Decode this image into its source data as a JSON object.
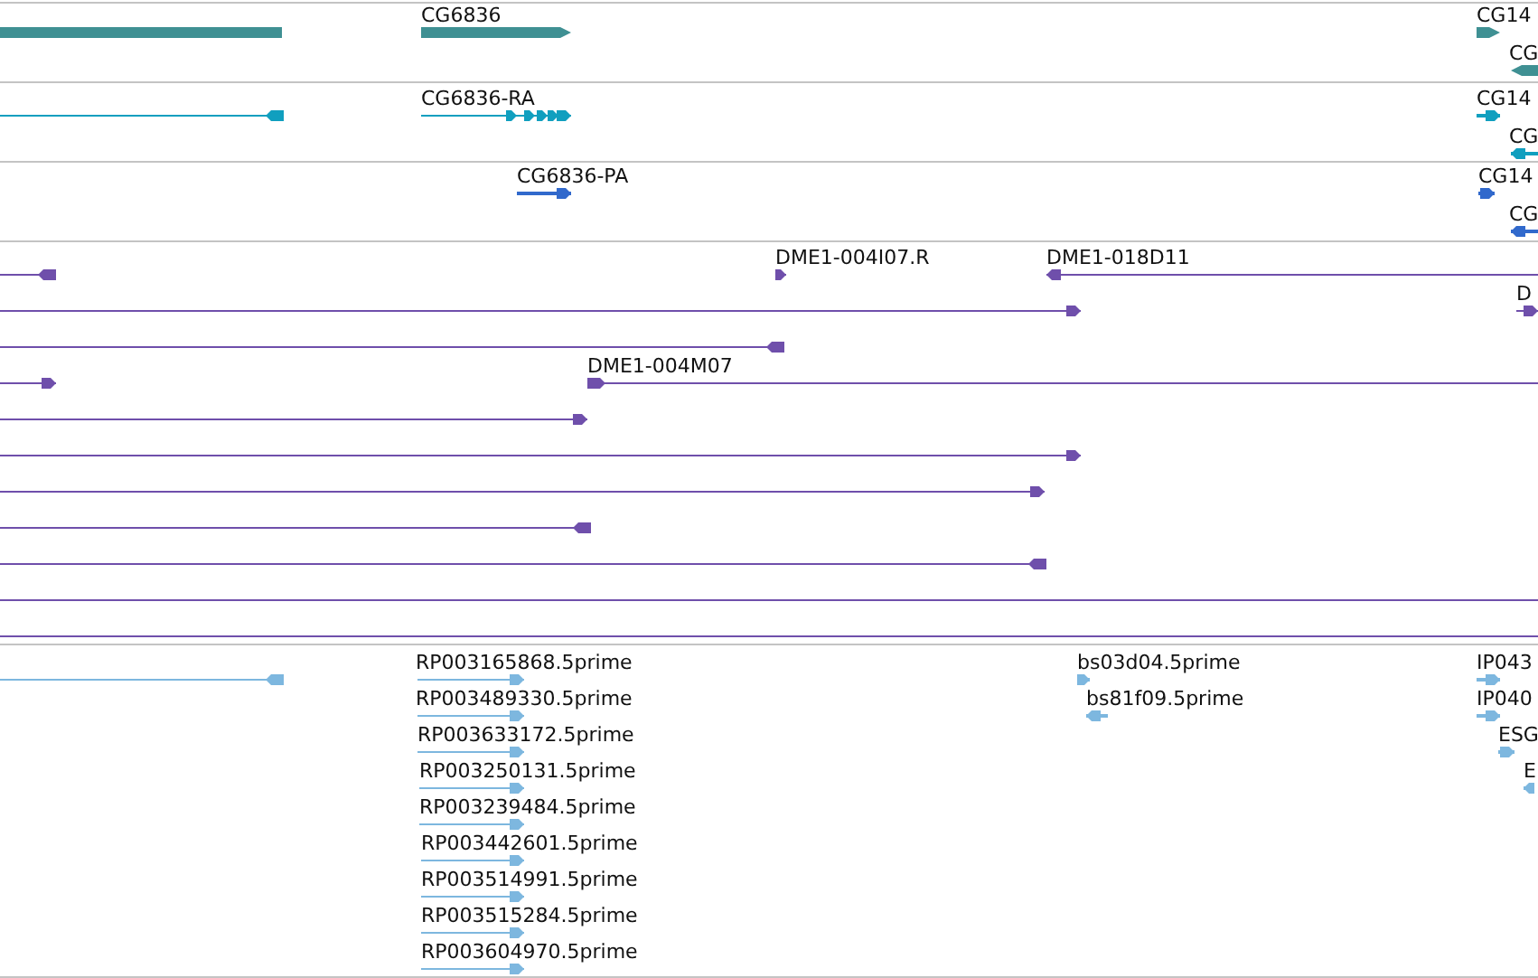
{
  "tracks": [
    {
      "kind": "gene",
      "color": "#3f9093",
      "features": [
        {
          "kind": "plain"
        },
        {
          "label": "CG6836",
          "reverse": false
        },
        {
          "label": "CG14",
          "reverse": false
        },
        {
          "label": "CG",
          "reverse": true
        }
      ]
    },
    {
      "kind": "transcript",
      "color": "#109fbf",
      "features": [
        {
          "reverse": true
        },
        {
          "label": "CG6836-RA",
          "reverse": false
        },
        {
          "label": "CG14",
          "reverse": false
        },
        {
          "label": "CG",
          "reverse": true
        }
      ]
    },
    {
      "kind": "cds",
      "color": "#3169cc",
      "features": [
        {
          "label": "CG6836-PA",
          "reverse": false
        },
        {
          "label": "CG14",
          "reverse": false
        },
        {
          "label": "CG",
          "reverse": true
        }
      ]
    },
    {
      "kind": "clone",
      "color": "#6f4fab",
      "features": [
        {
          "reverse": true
        },
        {
          "label": "DME1-004I07.R",
          "reverse": false
        },
        {
          "label": "DME1-018D11",
          "reverse": true
        },
        {
          "reverse": false
        },
        {
          "label": "D",
          "reverse": false
        },
        {
          "reverse": true
        },
        {
          "reverse": false
        },
        {
          "label": "DME1-004M07",
          "reverse": false
        },
        {
          "reverse": false
        },
        {
          "reverse": false
        },
        {
          "reverse": false
        },
        {
          "reverse": true
        },
        {
          "reverse": true
        },
        {
          "kind": "plain"
        },
        {
          "kind": "plain"
        }
      ]
    },
    {
      "kind": "est",
      "color": "#7db7df",
      "features": [
        {
          "reverse": true
        },
        {
          "label": "RP003165868.5prime",
          "reverse": false
        },
        {
          "label": "RP003489330.5prime",
          "reverse": false
        },
        {
          "label": "RP003633172.5prime",
          "reverse": false
        },
        {
          "label": "RP003250131.5prime",
          "reverse": false
        },
        {
          "label": "RP003239484.5prime",
          "reverse": false
        },
        {
          "label": "RP003442601.5prime",
          "reverse": false
        },
        {
          "label": "RP003514991.5prime",
          "reverse": false
        },
        {
          "label": "RP003515284.5prime",
          "reverse": false
        },
        {
          "label": "RP003604970.5prime",
          "reverse": false
        },
        {
          "label": "bs03d04.5prime",
          "reverse": false
        },
        {
          "label": "bs81f09.5prime",
          "reverse": true
        },
        {
          "label": "IP043",
          "reverse": false
        },
        {
          "label": "IP040",
          "reverse": false
        },
        {
          "label": "ESG",
          "reverse": false
        },
        {
          "label": "E",
          "reverse": true
        }
      ]
    }
  ]
}
